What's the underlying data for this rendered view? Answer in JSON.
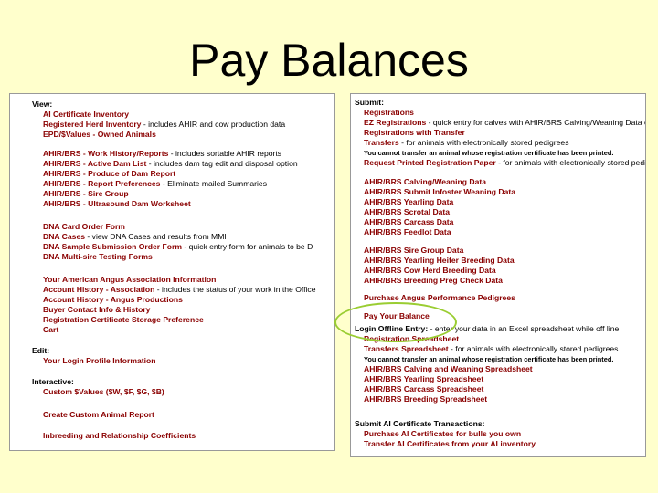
{
  "page_title": "Pay Balances",
  "left": {
    "view_heading": "View:",
    "view_items": [
      {
        "link": "AI Certificate Inventory",
        "desc": ""
      },
      {
        "link": "Registered Herd Inventory",
        "desc": " - includes AHIR and cow production data"
      },
      {
        "link": "EPD/$Values - Owned Animals",
        "desc": ""
      },
      {
        "link": "AHIR/BRS - Work History/Reports",
        "desc": " - includes sortable AHIR reports"
      },
      {
        "link": "AHIR/BRS - Active Dam List",
        "desc": " - includes dam tag edit and disposal option"
      },
      {
        "link": "AHIR/BRS - Produce of Dam Report",
        "desc": ""
      },
      {
        "link": "AHIR/BRS - Report Preferences",
        "desc": " - Eliminate mailed Summaries"
      },
      {
        "link": "AHIR/BRS - Sire Group",
        "desc": ""
      },
      {
        "link": "AHIR/BRS - Ultrasound Dam Worksheet",
        "desc": ""
      },
      {
        "link": "DNA Card Order Form",
        "desc": ""
      },
      {
        "link": "DNA Cases",
        "desc": " - view DNA Cases and results from MMI"
      },
      {
        "link": "DNA Sample Submission Order Form",
        "desc": " - quick entry form for animals to be D"
      },
      {
        "link": "DNA Multi-sire Testing Forms",
        "desc": ""
      },
      {
        "link": "Your American Angus Association Information",
        "desc": ""
      },
      {
        "link": "Account History - Association",
        "desc": " - includes the status of your work in the Office"
      },
      {
        "link": "Account History - Angus Productions",
        "desc": ""
      },
      {
        "link": "Buyer Contact Info & History",
        "desc": ""
      },
      {
        "link": "Registration Certificate Storage Preference",
        "desc": ""
      },
      {
        "link": "Cart",
        "desc": ""
      }
    ],
    "edit_heading": "Edit:",
    "edit_items": [
      {
        "link": "Your Login Profile Information",
        "desc": ""
      }
    ],
    "interactive_heading": "Interactive:",
    "interactive_items": [
      {
        "link": "Custom $Values ($W, $F, $G, $B)",
        "desc": ""
      },
      {
        "link": "Create Custom Animal Report",
        "desc": ""
      },
      {
        "link": "Inbreeding and Relationship Coefficients",
        "desc": ""
      }
    ]
  },
  "right": {
    "submit_heading": "Submit:",
    "submit_items": [
      {
        "link": "Registrations",
        "desc": ""
      },
      {
        "link": "EZ Registrations",
        "desc": " - quick entry for calves with AHIR/BRS Calving/Weaning Data ent"
      },
      {
        "link": "Registrations with Transfer",
        "desc": ""
      },
      {
        "link": "Transfers",
        "desc": " - for animals with electronically stored pedigrees"
      },
      {
        "link": "Request Printed Registration Paper",
        "desc": " - for animals with electronically stored pedig"
      },
      {
        "link": "AHIR/BRS Calving/Weaning Data",
        "desc": ""
      },
      {
        "link": "AHIR/BRS Submit Infoster Weaning Data",
        "desc": ""
      },
      {
        "link": "AHIR/BRS Yearling Data",
        "desc": ""
      },
      {
        "link": "AHIR/BRS Scrotal Data",
        "desc": ""
      },
      {
        "link": "AHIR/BRS Carcass Data",
        "desc": ""
      },
      {
        "link": "AHIR/BRS Feedlot Data",
        "desc": ""
      },
      {
        "link": "AHIR/BRS Sire Group Data",
        "desc": ""
      },
      {
        "link": "AHIR/BRS Yearling Heifer Breeding Data",
        "desc": ""
      },
      {
        "link": "AHIR/BRS Cow Herd Breeding Data",
        "desc": ""
      },
      {
        "link": "AHIR/BRS Breeding Preg Check Data",
        "desc": ""
      },
      {
        "link": "Purchase Angus Performance Pedigrees",
        "desc": ""
      },
      {
        "link": "Pay Your Balance",
        "desc": ""
      }
    ],
    "transfer_note": "You cannot transfer an animal whose registration certificate has been printed.",
    "offline_heading": "Login Offline Entry:",
    "offline_desc": " - enter your data in an Excel spreadsheet while off line",
    "offline_items": [
      {
        "link": "Registration Spreadsheet",
        "desc": ""
      },
      {
        "link": "Transfers Spreadsheet",
        "desc": " - for animals with electronically stored pedigrees"
      },
      {
        "link": "AHIR/BRS Calving and Weaning Spreadsheet",
        "desc": ""
      },
      {
        "link": "AHIR/BRS Yearling Spreadsheet",
        "desc": ""
      },
      {
        "link": "AHIR/BRS Carcass Spreadsheet",
        "desc": ""
      },
      {
        "link": "AHIR/BRS Breeding Spreadsheet",
        "desc": ""
      }
    ],
    "ai_heading": "Submit AI Certificate Transactions:",
    "ai_items": [
      {
        "link": "Purchase AI Certificates for bulls you own",
        "desc": ""
      },
      {
        "link": "Transfer AI Certificates from your AI inventory",
        "desc": ""
      }
    ]
  }
}
